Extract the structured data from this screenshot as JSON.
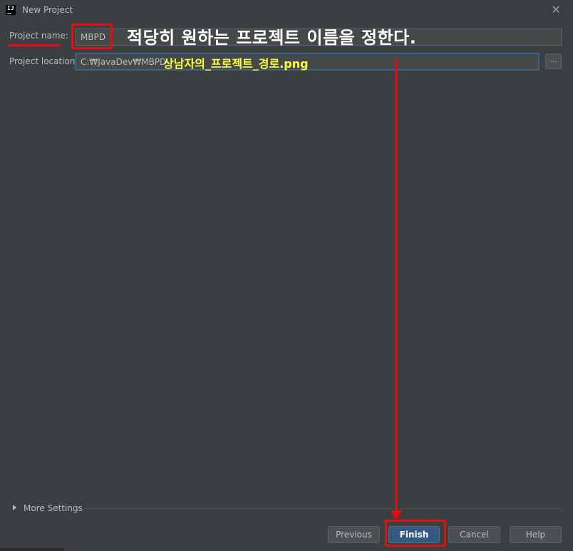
{
  "window": {
    "title": "New Project",
    "app_icon_text": "IJ"
  },
  "form": {
    "project_name_label": "Project name:",
    "project_name_value": "MBPD",
    "project_location_label": "Project location:",
    "project_location_value": "C:₩JavaDev₩MBPD",
    "browse_label": "..."
  },
  "annotations": {
    "heading": "적당히 원하는 프로젝트 이름을 정한다.",
    "location_note": "상남자의_프로젝트_경로.png",
    "highlight_color": "#e50d0d"
  },
  "more_settings": {
    "label": "More Settings"
  },
  "buttons": {
    "previous": "Previous",
    "finish": "Finish",
    "cancel": "Cancel",
    "help": "Help"
  },
  "icons": [
    "app-icon",
    "close-icon",
    "expand-triangle-icon"
  ]
}
